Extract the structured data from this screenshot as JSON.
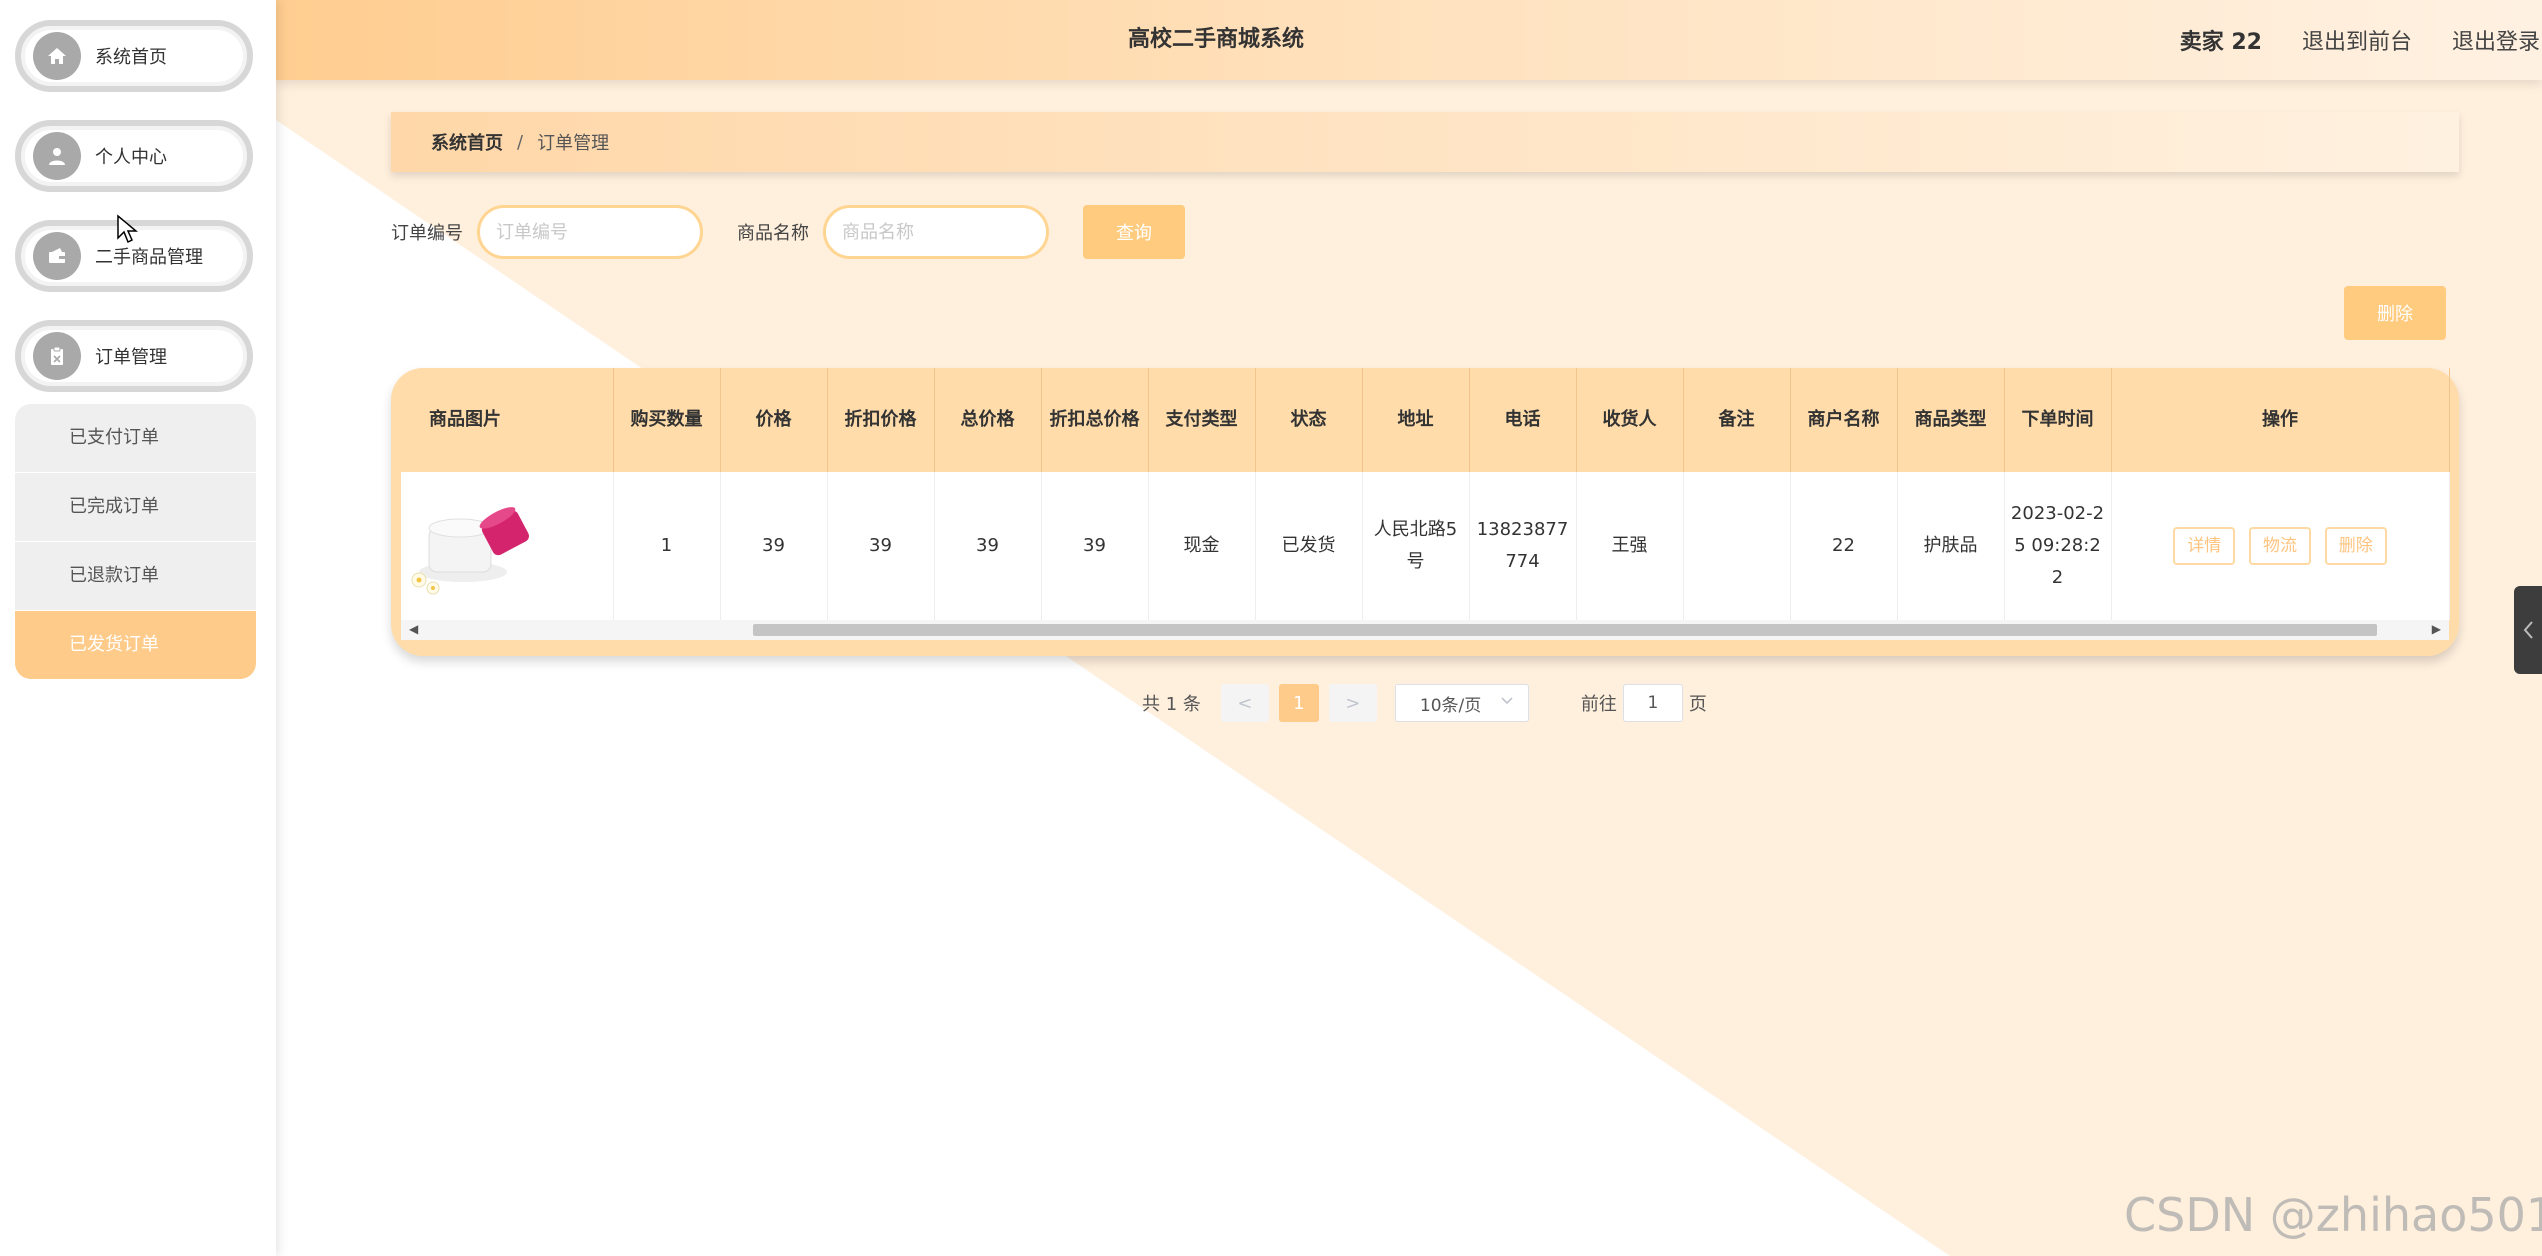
{
  "colors": {
    "accent": "#ffcb8a",
    "header_bg": "#ffd9a8",
    "tri_bg": "#ffefdd"
  },
  "header": {
    "title": "高校二手商城系统",
    "user": "卖家 22",
    "exit_front": "退出到前台",
    "logout": "退出登录"
  },
  "sidebar": {
    "items": [
      {
        "label": "系统首页",
        "icon": "home-icon"
      },
      {
        "label": "个人中心",
        "icon": "user-icon"
      },
      {
        "label": "二手商品管理",
        "icon": "wallet-icon"
      },
      {
        "label": "订单管理",
        "icon": "clipboard-icon"
      }
    ],
    "submenu": [
      "已支付订单",
      "已完成订单",
      "已退款订单",
      "已发货订单"
    ],
    "active_sub": "已发货订单"
  },
  "breadcrumb": {
    "home": "系统首页",
    "sep": "/",
    "current": "订单管理"
  },
  "search": {
    "order_no_label": "订单编号",
    "order_no_placeholder": "订单编号",
    "order_no_value": "",
    "goods_name_label": "商品名称",
    "goods_name_placeholder": "商品名称",
    "goods_name_value": "",
    "search_button": "查询"
  },
  "toolbar": {
    "delete_button": "删除"
  },
  "table": {
    "columns": [
      "商品图片",
      "购买数量",
      "价格",
      "折扣价格",
      "总价格",
      "折扣总价格",
      "支付类型",
      "状态",
      "地址",
      "电话",
      "收货人",
      "备注",
      "商户名称",
      "商品类型",
      "下单时间",
      "操作"
    ],
    "rows": [
      {
        "image": "cream-jar-image",
        "quantity": "1",
        "price": "39",
        "discount_price": "39",
        "total_price": "39",
        "discount_total": "39",
        "pay_type": "现金",
        "status": "已发货",
        "address": "人民北路5号",
        "phone": "13823877774",
        "receiver": "王强",
        "remark": "",
        "merchant": "22",
        "goods_type": "护肤品",
        "order_time": "2023-02-25 09:28:22",
        "actions": [
          "详情",
          "物流",
          "删除"
        ]
      }
    ]
  },
  "pagination": {
    "total_text": "共 1 条",
    "prev": "<",
    "current_page": "1",
    "next": ">",
    "page_size": "10条/页",
    "goto_label": "前往",
    "goto_value": "1",
    "page_unit": "页"
  },
  "watermark": "CSDN @zhihao501"
}
